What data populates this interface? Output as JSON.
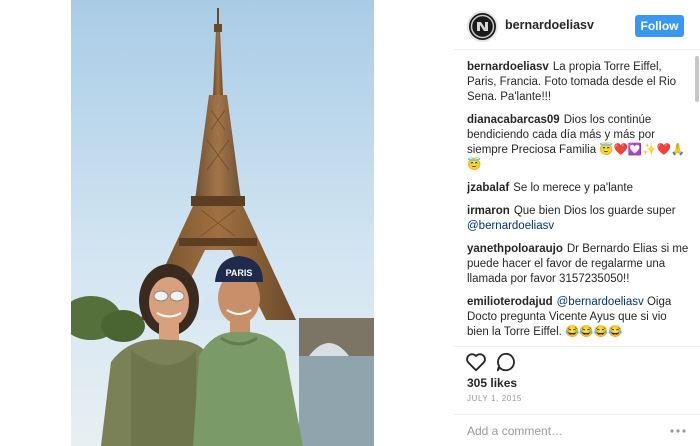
{
  "header": {
    "username": "bernardoeliasv",
    "follow_label": "Follow"
  },
  "photo": {
    "cap_text": "PARIS"
  },
  "comments": [
    {
      "user": "bernardoeliasv",
      "text": "La propia Torre Eiffel, Paris, Francia. Foto tomada desde el Rio Sena. Pa'lante!!!",
      "mention": "",
      "suffix": ""
    },
    {
      "user": "dianacabarcas09",
      "text": "Dios los continúe bendiciendo cada día más y más por siempre Preciosa Familia 😇❤️💟✨❤️🙏 😇",
      "mention": "",
      "suffix": ""
    },
    {
      "user": "jzabalaf",
      "text": "Se lo merece y pa'lante",
      "mention": "",
      "suffix": ""
    },
    {
      "user": "irmaron",
      "text": "Que bien Dios los guarde super",
      "mention": "@bernardoeliasv",
      "suffix": ""
    },
    {
      "user": "yanethpoloaraujo",
      "text": "Dr Bernardo Elias si me puede hacer el favor de regalarme una llamada por favor 3157235050!!",
      "mention": "",
      "suffix": ""
    },
    {
      "user": "emilioterodajud",
      "text": "",
      "mention": "@bernardoeliasv",
      "suffix": "Oiga Docto pregunta Vicente Ayus que si vio bien la Torre Eiffel. 😂😂😂😂 jajajajajajaajjaa, dice que esta mas grande que el Buque Bus de Argentina."
    }
  ],
  "actions": {
    "likes": "305 likes",
    "date": "JULY 1, 2015",
    "add_comment_placeholder": "Add a comment…"
  },
  "icons": {
    "like": "heart-icon",
    "comment": "comment-icon",
    "more": "more-icon"
  },
  "colors": {
    "follow_button": "#3897f0",
    "mention": "#003569"
  }
}
